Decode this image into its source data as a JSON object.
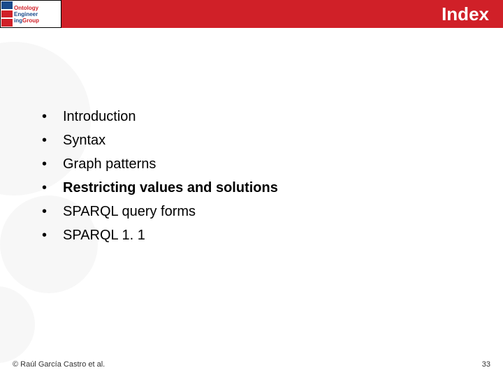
{
  "header": {
    "title": "Index",
    "logo": {
      "line1": "Ontology",
      "line2": "Engineer",
      "line3": "ing",
      "line3b": "Group"
    }
  },
  "items": [
    {
      "text": "Introduction",
      "bold": false
    },
    {
      "text": "Syntax",
      "bold": false
    },
    {
      "text": "Graph patterns",
      "bold": false
    },
    {
      "text": "Restricting values and solutions",
      "bold": true
    },
    {
      "text": "SPARQL query forms",
      "bold": false
    },
    {
      "text": "SPARQL 1. 1",
      "bold": false
    }
  ],
  "footer": {
    "copyright": "© Raúl García Castro et al.",
    "page": "33"
  }
}
